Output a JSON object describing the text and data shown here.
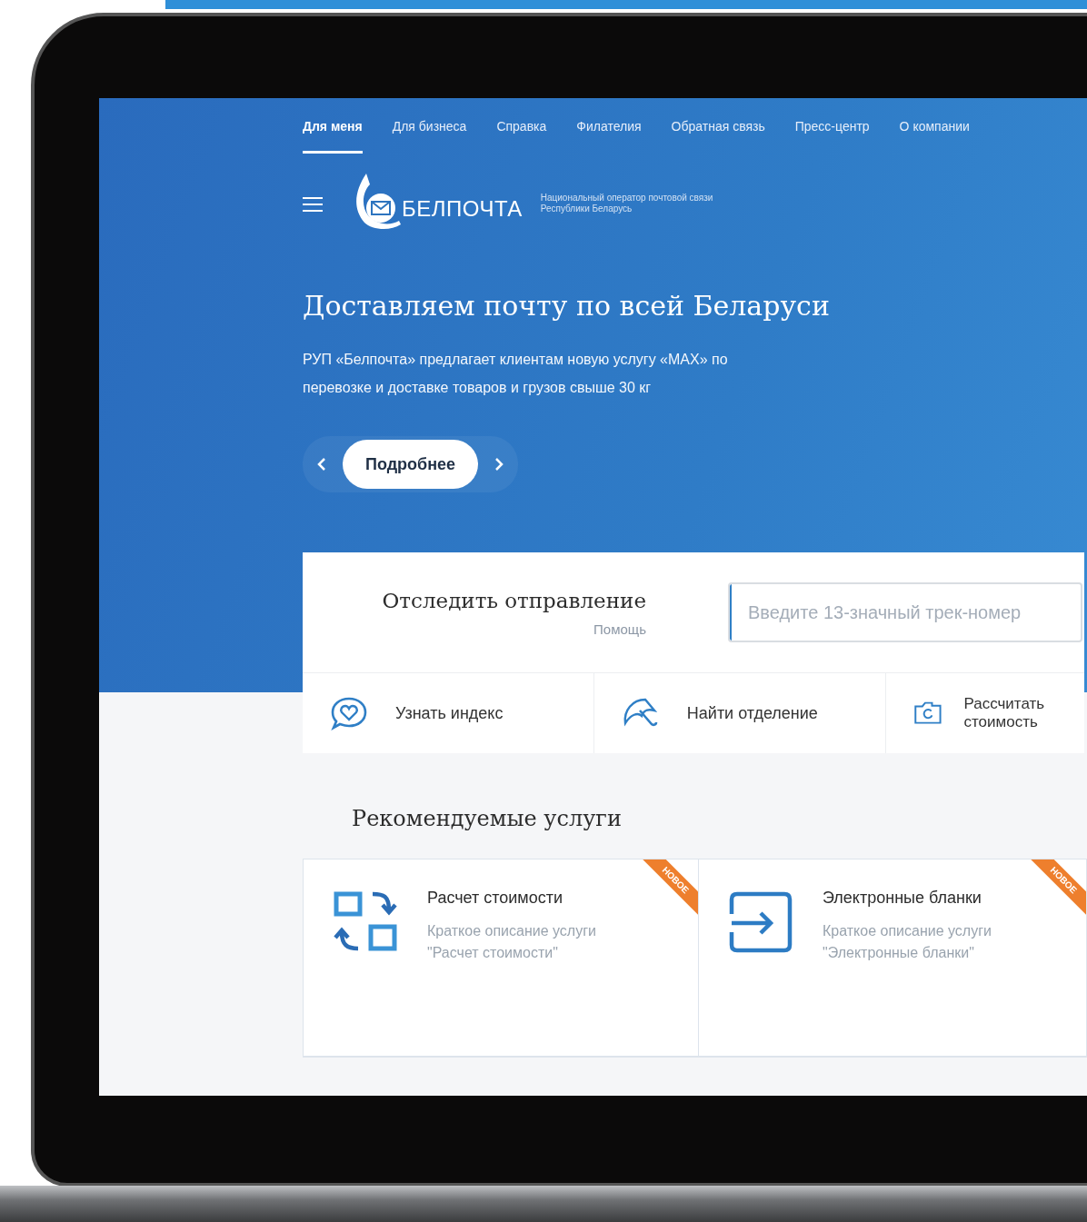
{
  "nav": {
    "tabs": [
      {
        "label": "Для меня",
        "selected": true
      },
      {
        "label": "Для бизнеса",
        "selected": false
      },
      {
        "label": "Справка",
        "selected": false
      },
      {
        "label": "Филателия",
        "selected": false
      },
      {
        "label": "Обратная связь",
        "selected": false
      },
      {
        "label": "Пресс-центр",
        "selected": false
      },
      {
        "label": "О компании",
        "selected": false
      }
    ]
  },
  "header": {
    "logo_text": "БЕЛПОЧТА",
    "tagline": [
      "Национальный оператор почтовой связи",
      "Республики Беларусь"
    ]
  },
  "hero": {
    "title": "Доставляем почту по всей Беларуси",
    "text": "РУП «Белпочта» предлагает клиентам новую услугу «MAX» по перевозке и доставке товаров и грузов свыше 30 кг",
    "button": "Подробнее"
  },
  "tracking": {
    "title": "Отследить отправление",
    "help": "Помощь",
    "placeholder": "Введите 13-значный трек-номер"
  },
  "quick_links": [
    {
      "label": "Узнать индекс",
      "kind": "chat"
    },
    {
      "label": "Найти отделение",
      "kind": "umbrella"
    },
    {
      "label": "Рассчитать стоимость",
      "kind": "camera"
    }
  ],
  "recommended": {
    "title": "Рекомендуемые услуги",
    "services": [
      {
        "title": "Расчет стоимости",
        "description": "Краткое описание услуги \"Расчет стоимости\"",
        "badge": "НОВОЕ",
        "kind": "exchange"
      },
      {
        "title": "Электронные бланки",
        "description": "Краткое описание услуги \"Электронные бланки\"",
        "badge": "НОВОЕ",
        "kind": "login"
      }
    ]
  }
}
